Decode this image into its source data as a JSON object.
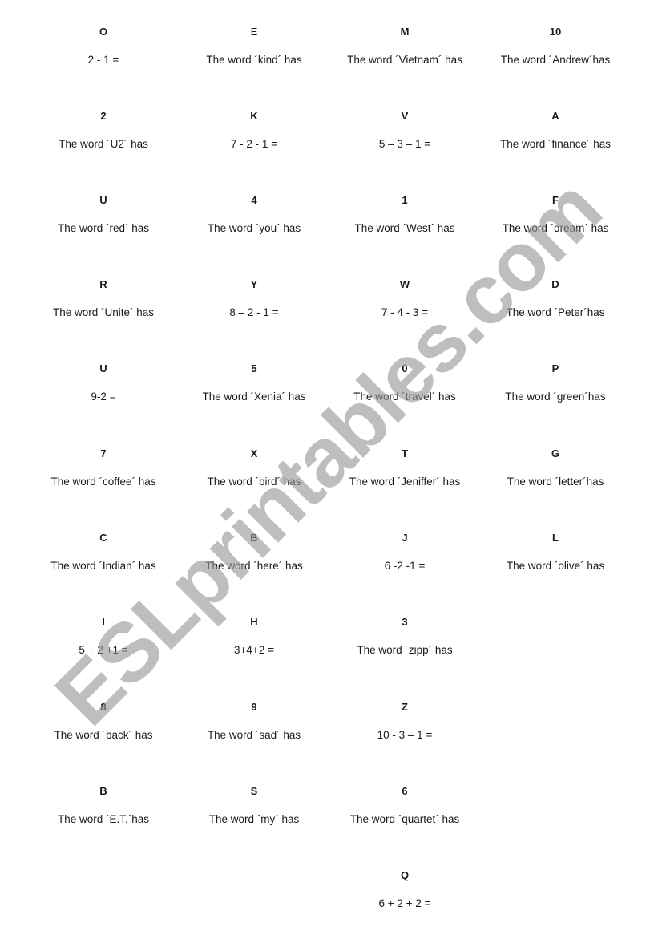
{
  "watermark": "ESLprintables.com",
  "cards": [
    {
      "key": "O",
      "clue": "2 - 1 ="
    },
    {
      "key": "E",
      "clue": "The word ´kind´ has"
    },
    {
      "key": "M",
      "clue": "The word ´Vietnam´ has"
    },
    {
      "key": "10",
      "clue": "The word ´Andrew´has"
    },
    {
      "key": "2",
      "clue": "The word ´U2´ has"
    },
    {
      "key": "K",
      "clue": "7 - 2 - 1 ="
    },
    {
      "key": "V",
      "clue": "5 – 3 – 1 ="
    },
    {
      "key": "A",
      "clue": "The word ´finance´ has"
    },
    {
      "key": "U",
      "clue": "The word ´red´ has"
    },
    {
      "key": "4",
      "clue": "The word ´you´ has"
    },
    {
      "key": "1",
      "clue": "The word ´West´ has"
    },
    {
      "key": "F",
      "clue": "The word ´dream´ has"
    },
    {
      "key": "R",
      "clue": "The word ´Unite´ has"
    },
    {
      "key": "Y",
      "clue": "8 – 2 - 1  ="
    },
    {
      "key": "W",
      "clue": "7 - 4 - 3 ="
    },
    {
      "key": "D",
      "clue": "The word ´Peter´has"
    },
    {
      "key": "U",
      "clue": "9-2 ="
    },
    {
      "key": "5",
      "clue": "The word ´Xenia´ has"
    },
    {
      "key": "0",
      "clue": "The word ´travel´ has"
    },
    {
      "key": "P",
      "clue": "The word ´green´has"
    },
    {
      "key": "7",
      "clue": "The word ´coffee´ has"
    },
    {
      "key": "X",
      "clue": "The word ´bird´ has"
    },
    {
      "key": "T",
      "clue": "The word ´Jeniffer´ has"
    },
    {
      "key": "G",
      "clue": "The word ´letter´has"
    },
    {
      "key": "C",
      "clue": "The word ´Indian´ has"
    },
    {
      "key": "B",
      "clue": "The word ´here´ has"
    },
    {
      "key": "J",
      "clue": "6 -2 -1 ="
    },
    {
      "key": "L",
      "clue": "The word ´olive´ has"
    },
    {
      "key": "I",
      "clue": "5 + 2 +1 ="
    },
    {
      "key": "H",
      "clue": "3+4+2 ="
    },
    {
      "key": "3",
      "clue": "The word ´zipp´ has"
    },
    {
      "key": "8",
      "clue": "The word ´back´ has"
    },
    {
      "key": "9",
      "clue": "The word ´sad´ has"
    },
    {
      "key": "Z",
      "clue": "10 - 3 – 1 ="
    },
    {
      "key": "B",
      "clue": "The word ´E.T.´has"
    },
    {
      "key": "S",
      "clue": "The word ´my´ has"
    },
    {
      "key": "6",
      "clue": "The word ´quartet´ has"
    },
    {
      "key": "Q",
      "clue": "6 + 2 + 2 ="
    }
  ]
}
